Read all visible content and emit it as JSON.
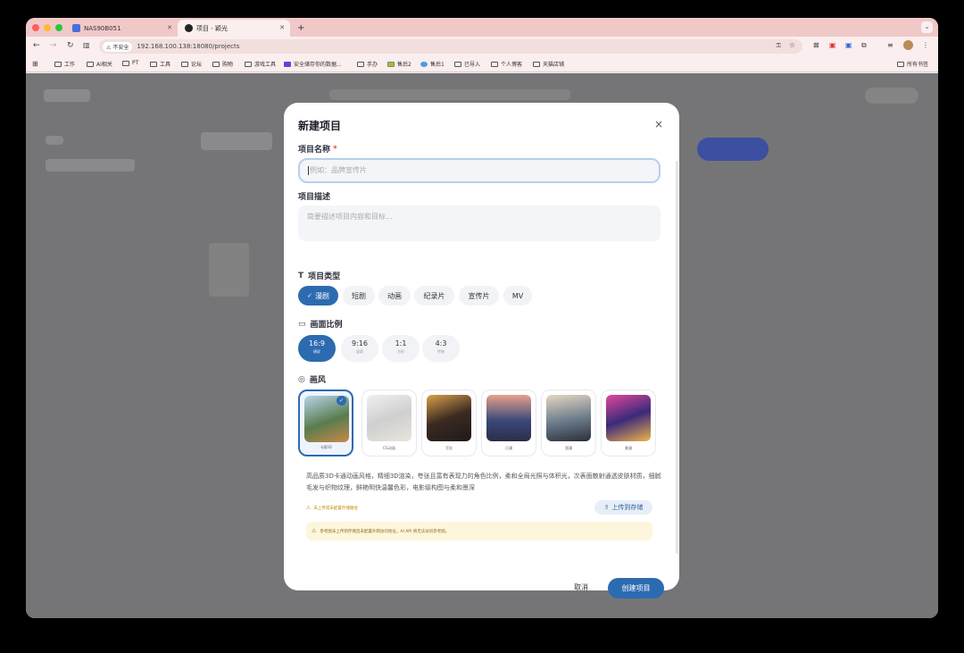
{
  "browser": {
    "tabs": [
      {
        "title": "NAS90B051"
      },
      {
        "title": "项目 - 颖光"
      }
    ],
    "new_tab": "+",
    "url": "192.168.100.138:18080/projects",
    "security_label": "不安全",
    "bookmarks": [
      "工作",
      "AI相关",
      "PT",
      "工具",
      "论坛",
      "购物",
      "游戏工具",
      "安全储存你的数据...",
      "手办",
      "售后2",
      "售后1",
      "已导入",
      "个人博客",
      "天猫店铺"
    ],
    "all_bookmarks": "所有书签"
  },
  "modal": {
    "title": "新建项目",
    "close_icon": "×",
    "name_label": "项目名称",
    "required_mark": "*",
    "name_placeholder": "例如：品牌宣传片",
    "desc_label": "项目描述",
    "desc_placeholder": "简要描述项目内容和目标...",
    "type_label": "项目类型",
    "types": [
      "漫剧",
      "短剧",
      "动画",
      "纪录片",
      "宣传片",
      "MV"
    ],
    "selected_type": "漫剧",
    "ratio_label": "画面比例",
    "ratios": [
      {
        "value": "16:9",
        "sub": "横屏"
      },
      {
        "value": "9:16",
        "sub": "竖屏"
      },
      {
        "value": "1:1",
        "sub": "方形"
      },
      {
        "value": "4:3",
        "sub": "传统"
      }
    ],
    "style_label": "画风",
    "styles": [
      "卡通3D",
      "CG动画",
      "写实",
      "日漫",
      "国漫",
      "美漫"
    ],
    "style_description": "高品质3D卡通动画风格，精细3D渲染，夸张且富有表现力的角色比例，柔和全局光照与体积光，次表面散射通透皮肤材质，细腻毛发与织物纹理，鲜艳明快温馨色彩，电影级构图与柔和景深",
    "warning": "未上传或未配置存储路径",
    "upload_button": "上传到存储",
    "notice": "参考图未上传到存储且未配置外网访问地址，AI API 将无法访问参考图。",
    "cancel_button": "取消",
    "create_button": "创建项目"
  },
  "colors": {
    "accent": "#2d6bb0"
  }
}
